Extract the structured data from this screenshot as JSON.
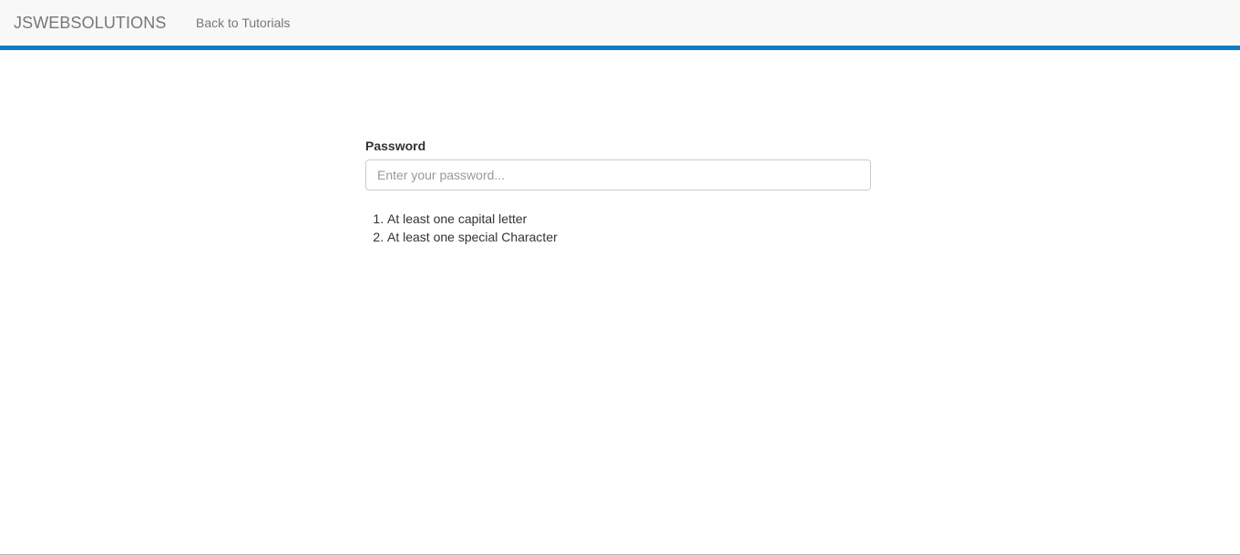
{
  "navbar": {
    "brand": "JSWEBSOLUTIONS",
    "back_link": "Back to Tutorials",
    "accent_color": "#0f7ac7"
  },
  "form": {
    "password_label": "Password",
    "password_placeholder": "Enter your password...",
    "password_value": ""
  },
  "rules": [
    "At least one capital letter",
    "At least one special Character"
  ]
}
